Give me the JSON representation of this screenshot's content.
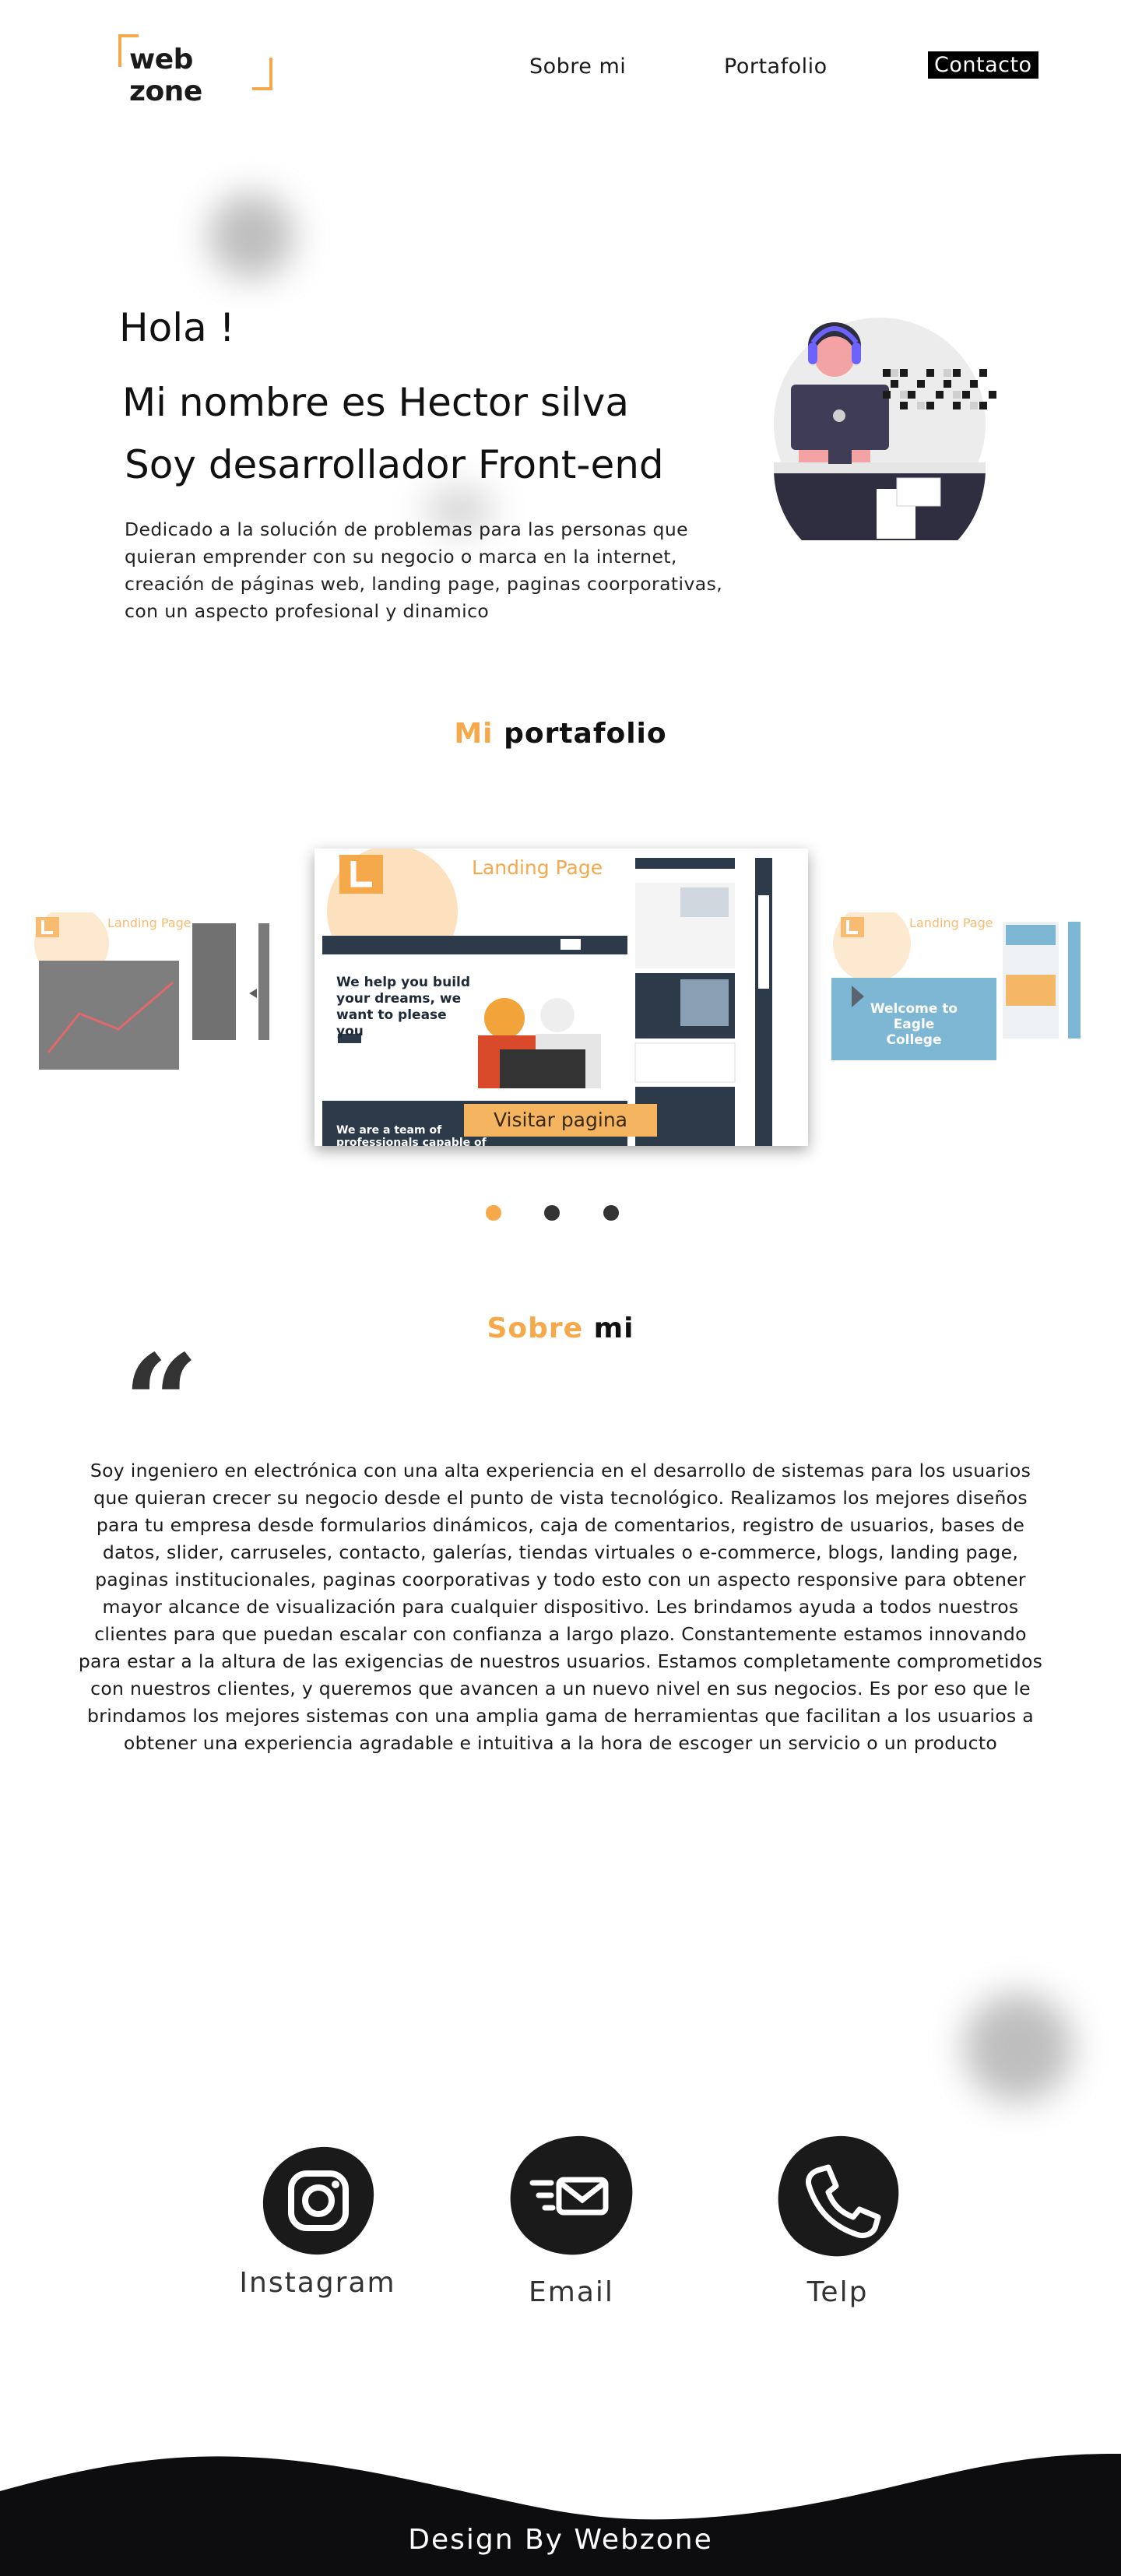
{
  "header": {
    "logo_text": "web zone",
    "nav": [
      {
        "label": "Sobre mi"
      },
      {
        "label": "Portafolio"
      },
      {
        "label": "Contacto"
      }
    ]
  },
  "hero": {
    "greeting": "Hola !",
    "name_line": "Mi nombre es Hector silva",
    "role_line": "Soy desarrollador Front-end",
    "description": "Dedicado a la solución de problemas para las personas que quieran emprender con su negocio o marca en la internet, creación de páginas web, landing page, paginas coorporativas, con un aspecto profesional y dinamico"
  },
  "portfolio": {
    "title_accent": "Mi",
    "title_rest": " portafolio",
    "center_slide": {
      "label": "Landing Page",
      "headline": "We help you build your dreams, we want to please you",
      "about_heading": "We are a team of professionals capable of",
      "button": "Visitar pagina"
    },
    "left_slide": {
      "label": "Landing Page"
    },
    "right_slide": {
      "label": "Landing Page",
      "headline": "Welcome to Eagle College"
    },
    "dots": 3,
    "active_dot": 0
  },
  "about": {
    "title_accent": "Sobre",
    "title_rest": " mi",
    "quote_glyph": "“",
    "text": "Soy ingeniero en electrónica con una alta experiencia en el desarrollo de sistemas para los usuarios que quieran crecer su negocio desde el punto de vista tecnológico. Realizamos los mejores diseños para tu empresa desde formularios dinámicos, caja de comentarios, registro de usuarios, bases de datos, slider, carruseles, contacto, galerías, tiendas virtuales o e-commerce, blogs, landing page, paginas institucionales, paginas coorporativas y todo esto con un aspecto responsive para obtener mayor alcance de visualización para cualquier dispositivo. Les brindamos ayuda a todos nuestros clientes para que puedan escalar con confianza a largo plazo. Constantemente estamos innovando para estar a la altura de las exigencias de nuestros usuarios. Estamos completamente comprometidos con nuestros clientes, y queremos que avancen a un nuevo nivel en sus negocios. Es por eso que le brindamos los mejores sistemas con una amplia gama de herramientas que facilitan a los usuarios a obtener una experiencia agradable e intuitiva a la hora de escoger un servicio o un producto"
  },
  "contact": {
    "items": [
      {
        "label": "Instagram",
        "icon": "instagram-icon"
      },
      {
        "label": "Email",
        "icon": "email-icon"
      },
      {
        "label": "Telp",
        "icon": "phone-icon"
      }
    ]
  },
  "footer": {
    "text": "Design By Webzone"
  },
  "colors": {
    "accent": "#f5a94a",
    "dark": "#111111",
    "footer_bg": "#0d0d0f"
  }
}
